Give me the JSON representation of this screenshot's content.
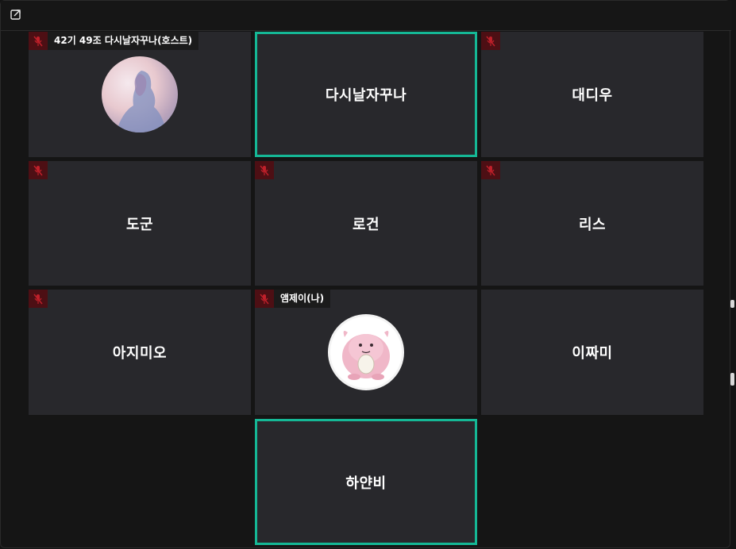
{
  "colors": {
    "accent": "#15b896",
    "tile_bg": "#28282c",
    "muted_badge": "#4d0f14"
  },
  "topbar": {
    "popout_icon": "popout-icon"
  },
  "participants": {
    "p1": {
      "tag": "42기 49조 다시날자꾸나(호스트)",
      "muted": true,
      "avatar": "host-profile-photo"
    },
    "p2": {
      "name": "다시날자꾸나",
      "speaking": true
    },
    "p3": {
      "name": "대디우",
      "muted": true
    },
    "p4": {
      "name": "도군",
      "muted": true
    },
    "p5": {
      "name": "로건",
      "muted": true
    },
    "p6": {
      "name": "리스",
      "muted": true
    },
    "p7": {
      "name": "아지미오",
      "muted": true
    },
    "p8": {
      "tag": "앰제이(나)",
      "muted": true,
      "avatar": "chansey-avatar"
    },
    "p9": {
      "name": "이짜미"
    },
    "p10": {
      "name": "하얀비",
      "speaking": true
    }
  }
}
